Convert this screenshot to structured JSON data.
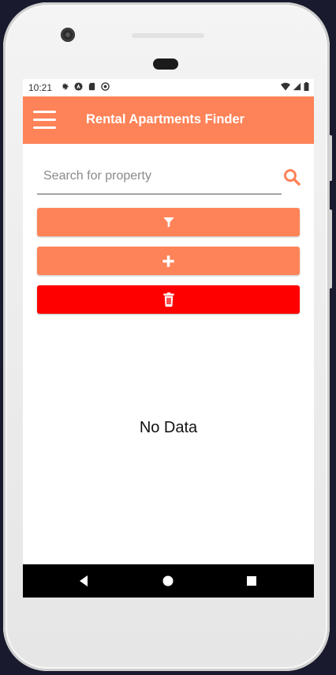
{
  "status_bar": {
    "time": "10:21",
    "left_icons": [
      "gear-icon",
      "vpn-icon",
      "sd-card-icon",
      "sync-icon"
    ],
    "right_icons": [
      "wifi-icon",
      "signal-icon",
      "battery-icon"
    ]
  },
  "app_bar": {
    "title": "Rental Apartments Finder",
    "menu_icon": "hamburger-menu-icon",
    "color": "#ff8358"
  },
  "search": {
    "placeholder": "Search for property",
    "value": "",
    "icon": "search-icon"
  },
  "actions": [
    {
      "name": "filter",
      "icon": "filter-icon",
      "color": "#ff8358"
    },
    {
      "name": "add",
      "icon": "plus-icon",
      "color": "#ff8358"
    },
    {
      "name": "delete",
      "icon": "trash-icon",
      "color": "#ff0000"
    }
  ],
  "empty_state": {
    "message": "No Data"
  },
  "nav_bar": {
    "buttons": [
      "back-icon",
      "home-icon",
      "recents-icon"
    ]
  }
}
